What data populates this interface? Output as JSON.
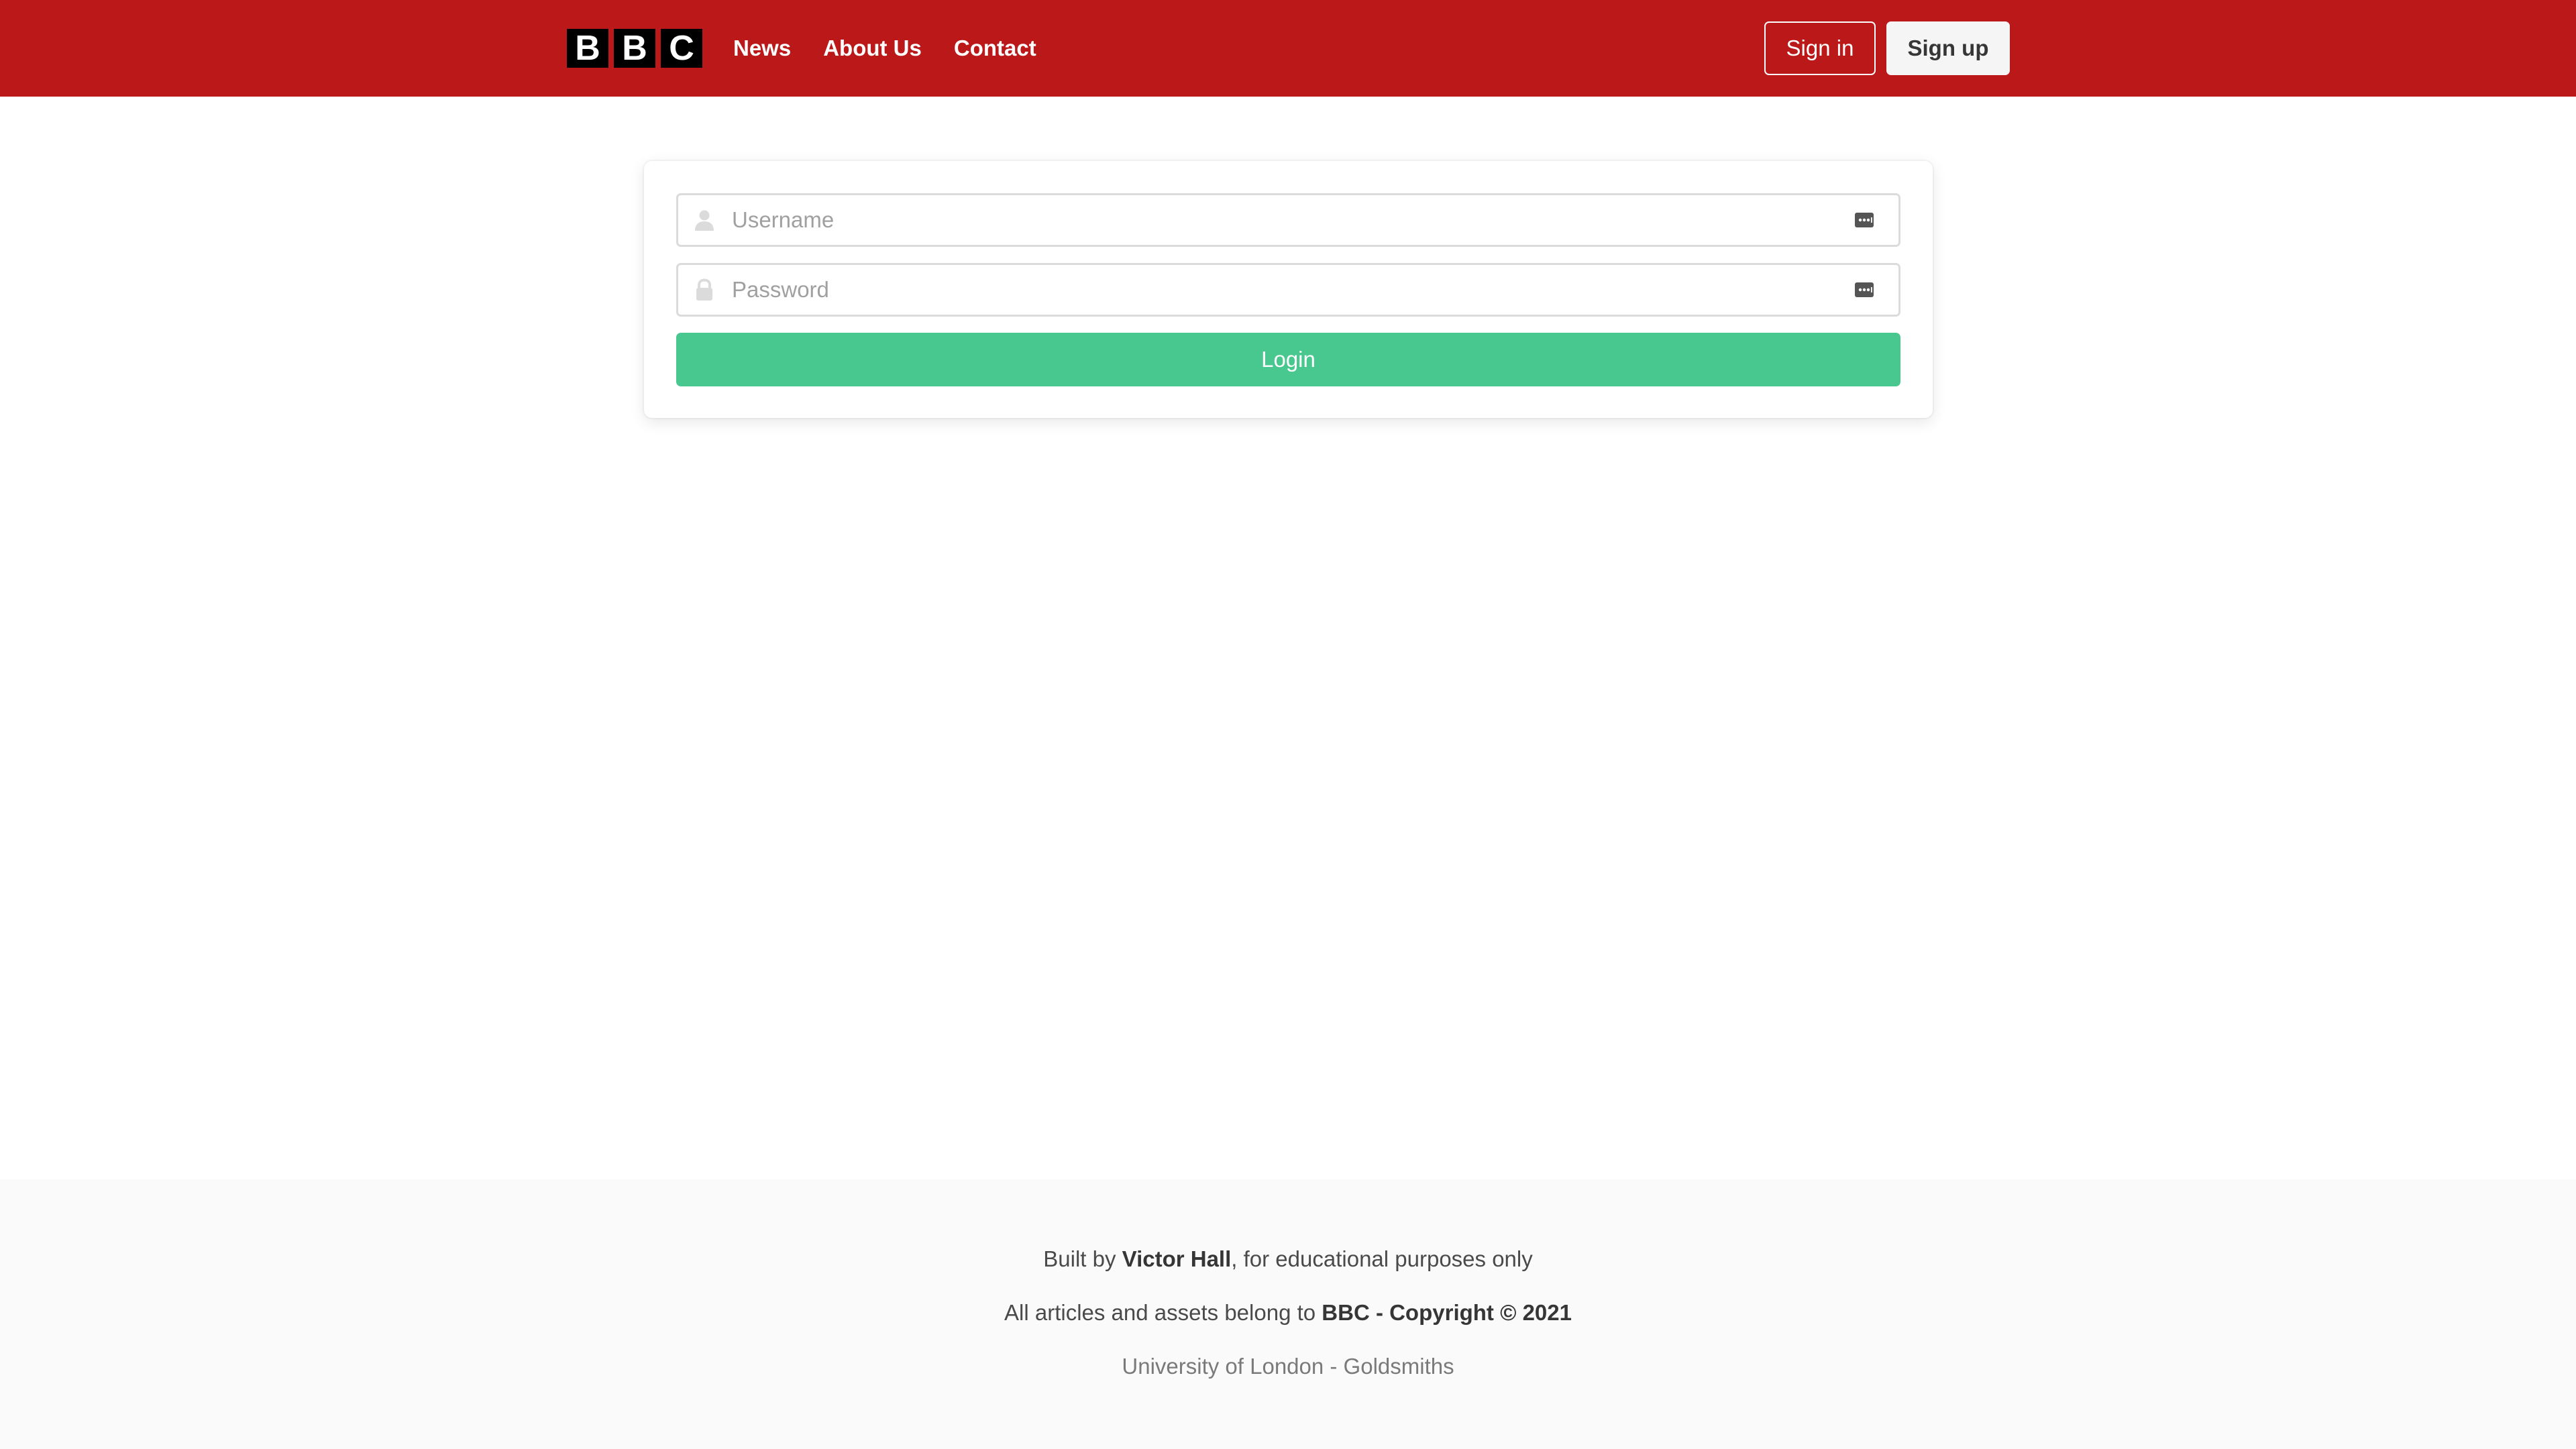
{
  "colors": {
    "navbar_bg": "#bb1919",
    "login_button_bg": "#48c78e",
    "footer_bg": "#fafafa"
  },
  "navbar": {
    "logo_letters": [
      "B",
      "B",
      "C"
    ],
    "links": [
      {
        "label": "News"
      },
      {
        "label": "About Us"
      },
      {
        "label": "Contact"
      }
    ],
    "signin_label": "Sign in",
    "signup_label": "Sign up"
  },
  "login_form": {
    "username": {
      "placeholder": "Username",
      "value": "",
      "left_icon": "user-icon",
      "right_icon": "password-manager-icon"
    },
    "password": {
      "placeholder": "Password",
      "value": "",
      "left_icon": "lock-icon",
      "right_icon": "password-manager-icon"
    },
    "submit_label": "Login"
  },
  "footer": {
    "line1_prefix": "Built by ",
    "line1_name": "Victor Hall",
    "line1_suffix": ", for educational purposes only",
    "line2_prefix": "All articles and assets belong to ",
    "line2_bold": "BBC - Copyright © 2021",
    "line3": "University of London - Goldsmiths"
  }
}
